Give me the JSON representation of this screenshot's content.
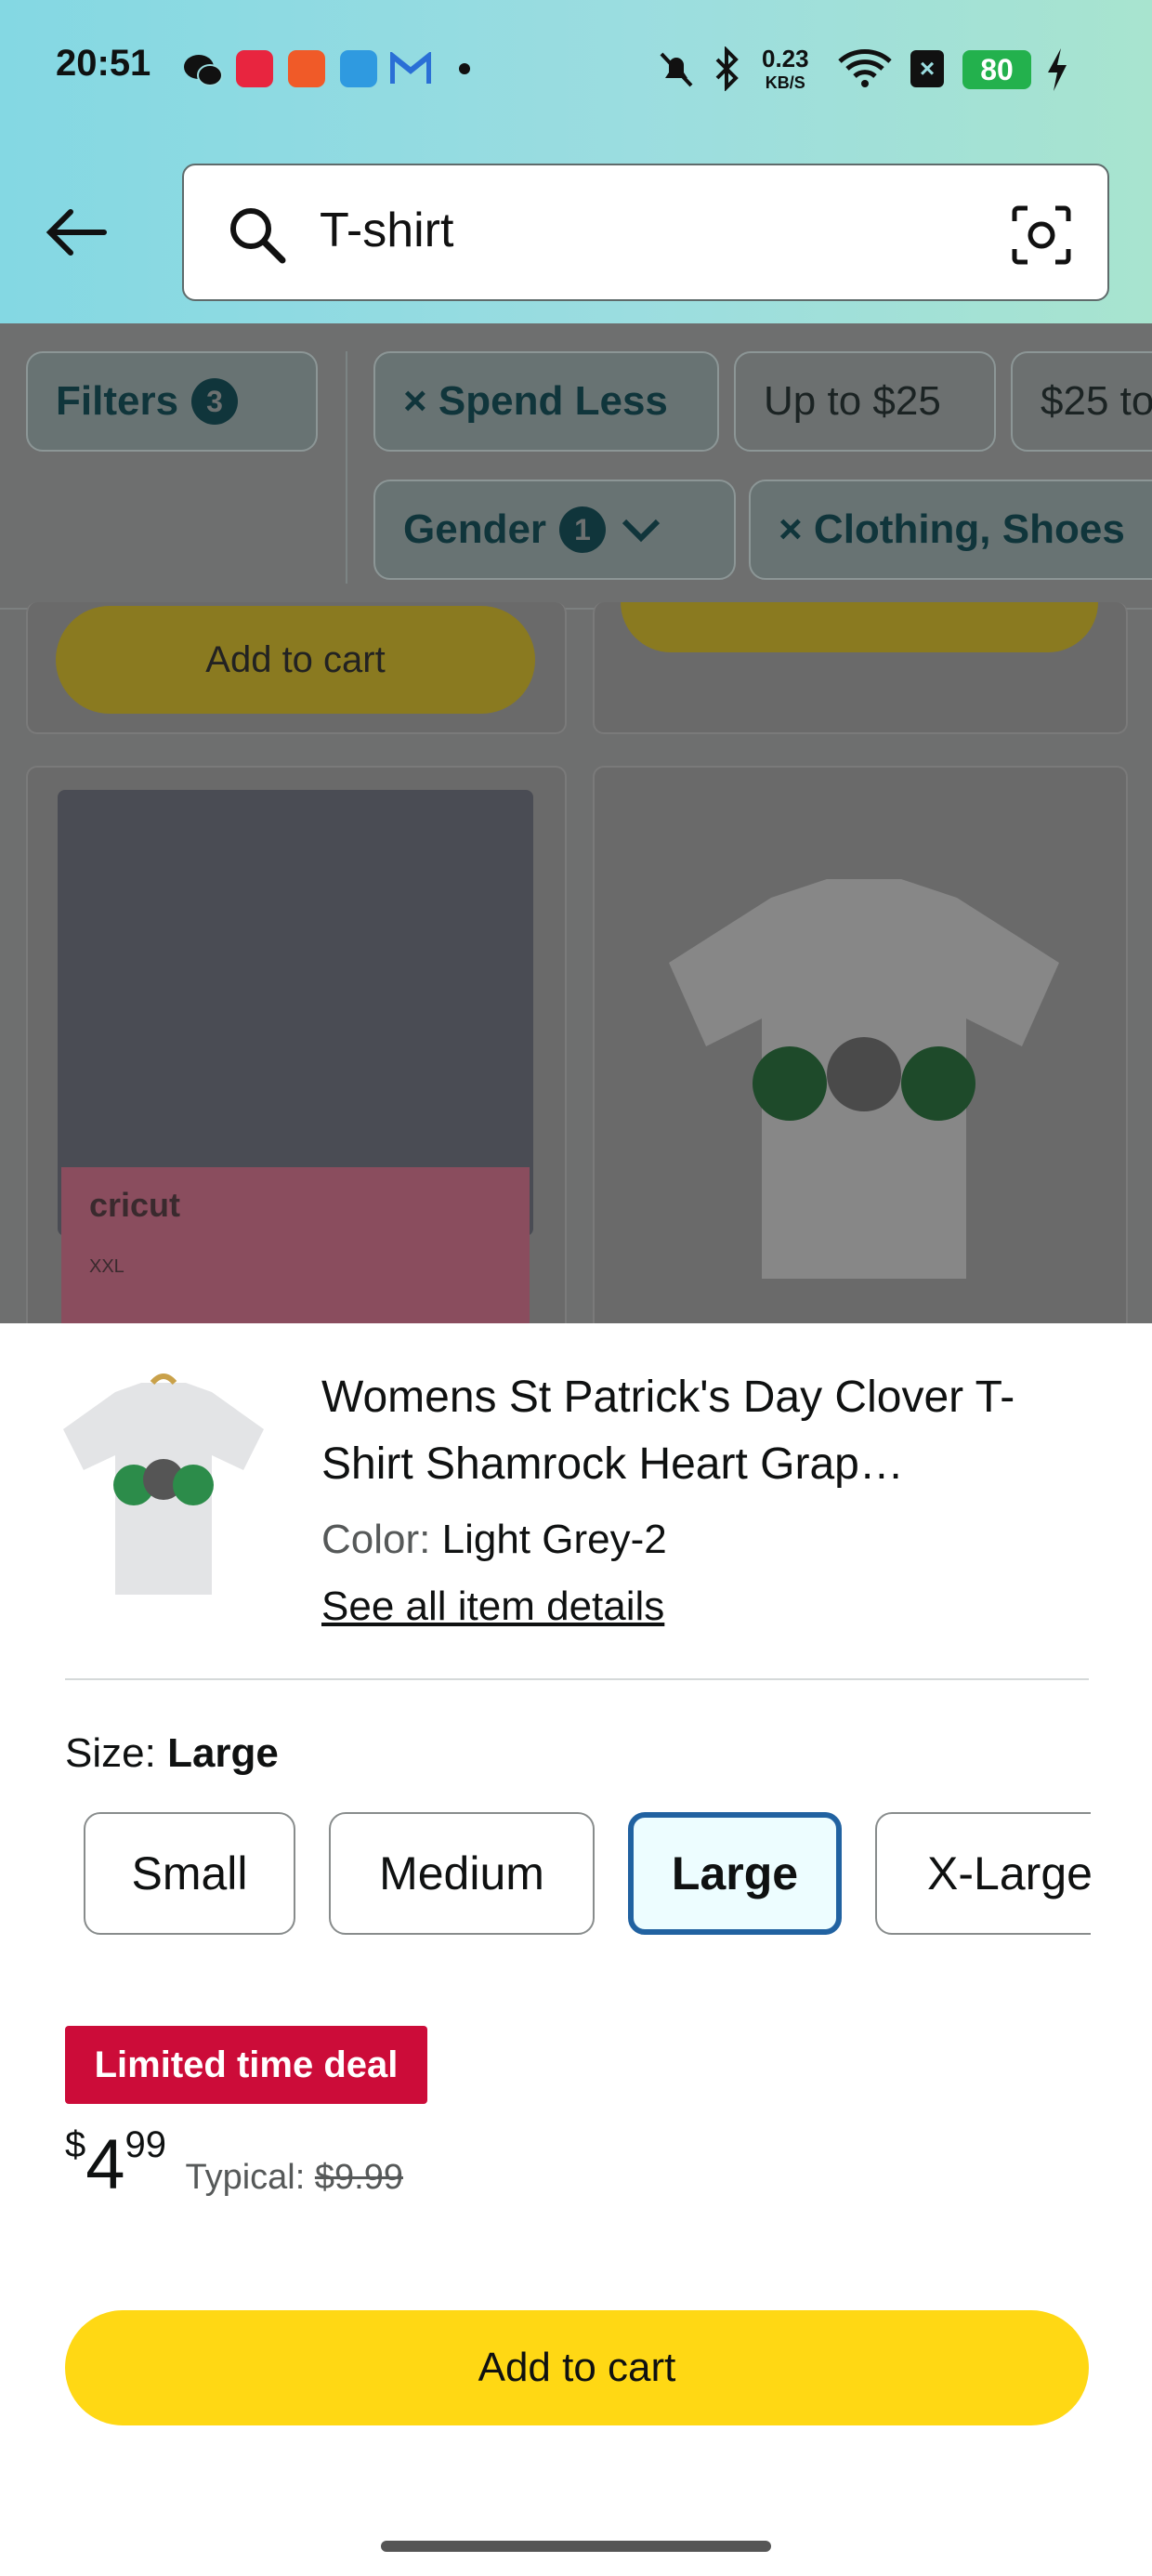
{
  "status_bar": {
    "time": "20:51",
    "net_speed": "0.23",
    "net_unit": "KB/S",
    "battery": "80",
    "icons": [
      "wechat-icon",
      "app-icon",
      "app-icon",
      "qq-icon",
      "gmail-icon",
      "dot-icon",
      "mute-icon",
      "bluetooth-icon",
      "wifi-icon",
      "battery-icon",
      "charging-icon"
    ]
  },
  "header": {
    "back_icon": "back-arrow-icon",
    "search_value": "T-shirt",
    "camera_icon": "camera-search-icon"
  },
  "filters": {
    "filters_label": "Filters",
    "filters_count": "3",
    "chips": [
      {
        "label": "× Spend Less"
      },
      {
        "label": "Up to $25"
      },
      {
        "label": "$25 to"
      }
    ],
    "gender_label": "Gender",
    "gender_count": "1",
    "clothing_label": "× Clothing, Shoes"
  },
  "background": {
    "add_to_cart_label": "Add to cart",
    "card_brand_text": "cricut",
    "card_size_text": "XXL"
  },
  "sheet": {
    "title": "Womens St Patrick's Day Clover T-Shirt Shamrock Heart Grap…",
    "color_label": "Color:",
    "color_value": "Light Grey-2",
    "details_link": "See all item details",
    "size_label": "Size:",
    "size_value": "Large",
    "sizes": [
      "Small",
      "Medium",
      "Large",
      "X-Large"
    ],
    "selected_size": "Large",
    "deal_badge": "Limited time deal",
    "price_symbol": "$",
    "price_whole": "4",
    "price_fraction": "99",
    "typical_label": "Typical:",
    "typical_price": "$9.99",
    "add_to_cart": "Add to cart"
  },
  "colors": {
    "accent_yellow": "#ffd814",
    "deal_red": "#cc0c39",
    "selected_blue": "#2162a1"
  }
}
